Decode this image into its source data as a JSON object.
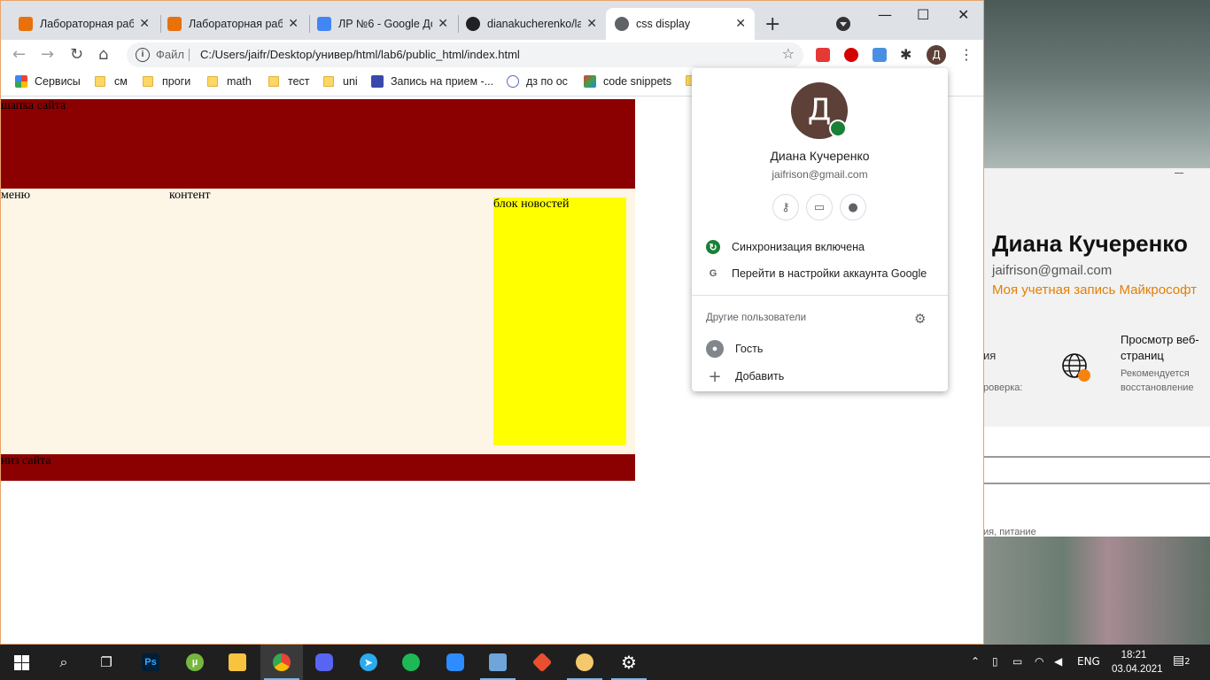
{
  "tabs": [
    {
      "title": "Лабораторная раб",
      "favicon_color": "#e8710a",
      "active": false
    },
    {
      "title": "Лабораторная раб",
      "favicon_color": "#e8710a",
      "active": false
    },
    {
      "title": "ЛР №6 - Google До",
      "favicon_color": "#4285f4",
      "active": false
    },
    {
      "title": "dianakucherenko/la",
      "favicon_color": "#202124",
      "active": false
    },
    {
      "title": "css display",
      "favicon_color": "#5f6368",
      "active": true
    }
  ],
  "toolbar": {
    "scheme": "Файл",
    "url": "C:/Users/jaifr/Desktop/универ/html/lab6/public_html/index.html",
    "profile_initial": "Д"
  },
  "bookmarks": [
    {
      "label": "Сервисы",
      "kind": "apps"
    },
    {
      "label": "см",
      "kind": "folder"
    },
    {
      "label": "проги",
      "kind": "folder"
    },
    {
      "label": "math",
      "kind": "folder"
    },
    {
      "label": "тест",
      "kind": "folder"
    },
    {
      "label": "uni",
      "kind": "folder"
    },
    {
      "label": "Запись на прием -...",
      "kind": "site"
    },
    {
      "label": "дз по ос",
      "kind": "site"
    },
    {
      "label": "code snippets",
      "kind": "site"
    }
  ],
  "page": {
    "header": "шапка сайта",
    "menu": "меню",
    "content": "контент",
    "news": "блок новостей",
    "footer": "низ сайта",
    "colors": {
      "header": "#8b0000",
      "middle": "#fdf5e6",
      "news": "#ffff00"
    }
  },
  "profile_popup": {
    "initial": "Д",
    "name": "Диана Кучеренко",
    "email": "jaifrison@gmail.com",
    "sync": "Синхронизация включена",
    "manage": "Перейти в настройки аккаунта Google",
    "other_users": "Другие пользователи",
    "guest": "Гость",
    "add": "Добавить"
  },
  "settings_window": {
    "name": "Диана Кучеренко",
    "email": "jaifrison@gmail.com",
    "ms_account": "Моя учетная запись Майкрософт",
    "cut1": "ия",
    "cut2": "роверка:",
    "tile_title": "Просмотр веб-страниц",
    "tile_sub": "Рекомендуется восстановление",
    "cut3": "ия, питание"
  },
  "taskbar": {
    "lang": "ENG",
    "time": "18:21",
    "date": "03.04.2021",
    "notifications": "2"
  }
}
